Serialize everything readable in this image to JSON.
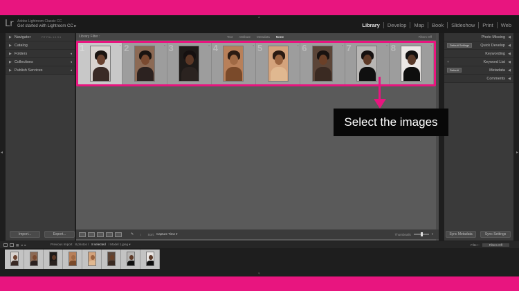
{
  "app": {
    "logo": "Lr",
    "user_line1": "Adobe Lightroom Classic CC",
    "user_line2": "Get started with Lightroom CC ▸"
  },
  "modules": [
    "Library",
    "Develop",
    "Map",
    "Book",
    "Slideshow",
    "Print",
    "Web"
  ],
  "active_module": "Library",
  "left_panels": [
    {
      "label": "Navigator",
      "extra": "FIT  FILL  1:1  3:1"
    },
    {
      "label": "Catalog",
      "extra": ""
    },
    {
      "label": "Folders",
      "extra": ""
    },
    {
      "label": "Collections",
      "extra": ""
    },
    {
      "label": "Publish Services",
      "extra": ""
    }
  ],
  "left_buttons": {
    "import": "Import...",
    "export": "Export..."
  },
  "library_filter": {
    "title": "Library Filter :",
    "options": [
      "Text",
      "Attribute",
      "Metadata",
      "None"
    ],
    "active": "None",
    "preset": "Filters Off"
  },
  "grid": {
    "cells": [
      {
        "num": "1",
        "selected": true,
        "skin": "#6b4330",
        "hair": "#1b1410",
        "cloth": "#3a2a25",
        "bg": "#d9d3cf"
      },
      {
        "num": "2",
        "selected": false,
        "skin": "#7a4a30",
        "hair": "#1a1411",
        "cloth": "#2c2220",
        "bg": "#8c6a55"
      },
      {
        "num": "3",
        "selected": false,
        "skin": "#5c3826",
        "hair": "#151010",
        "cloth": "#2b2320",
        "bg": "#1e1a18"
      },
      {
        "num": "4",
        "selected": false,
        "skin": "#a06a45",
        "hair": "#2a1a12",
        "cloth": "#7a4a2a",
        "bg": "#b8805a"
      },
      {
        "num": "5",
        "selected": false,
        "skin": "#9a6440",
        "hair": "#2a1a12",
        "cloth": "#e0b890",
        "bg": "#d4a37c"
      },
      {
        "num": "6",
        "selected": false,
        "skin": "#6b4028",
        "hair": "#181210",
        "cloth": "#3a2a22",
        "bg": "#5b4538"
      },
      {
        "num": "7",
        "selected": false,
        "skin": "#5e3a28",
        "hair": "#151010",
        "cloth": "#101010",
        "bg": "#b8b6b4"
      },
      {
        "num": "8",
        "selected": false,
        "skin": "#5a3a2a",
        "hair": "#121010",
        "cloth": "#0e0e0e",
        "bg": "#ece8e6"
      }
    ]
  },
  "toolbar": {
    "sort_label": "Sort:",
    "sort_value": "Capture Time ▾",
    "thumbnails_label": "Thumbnails"
  },
  "right_panels": [
    {
      "label": "Photo Missing",
      "left": ""
    },
    {
      "label": "Quick Develop",
      "left": "Default Settings"
    },
    {
      "label": "Keywording",
      "left": ""
    },
    {
      "label": "Keyword List",
      "left": ""
    },
    {
      "label": "Metadata",
      "left": "Default"
    },
    {
      "label": "Comments",
      "left": ""
    }
  ],
  "right_buttons": {
    "sync_metadata": "Sync Metadata",
    "sync_settings": "Sync Settings"
  },
  "filmstrip_bar": {
    "source": "Previous Import",
    "count": "8 photos /",
    "selected": "8 selected",
    "file": "/ Model 1.jpeg ▾",
    "filter_label": "Filter :",
    "filter_value": "Filters Off"
  },
  "callout": {
    "text": "Select the images",
    "color": "#e8157f"
  }
}
